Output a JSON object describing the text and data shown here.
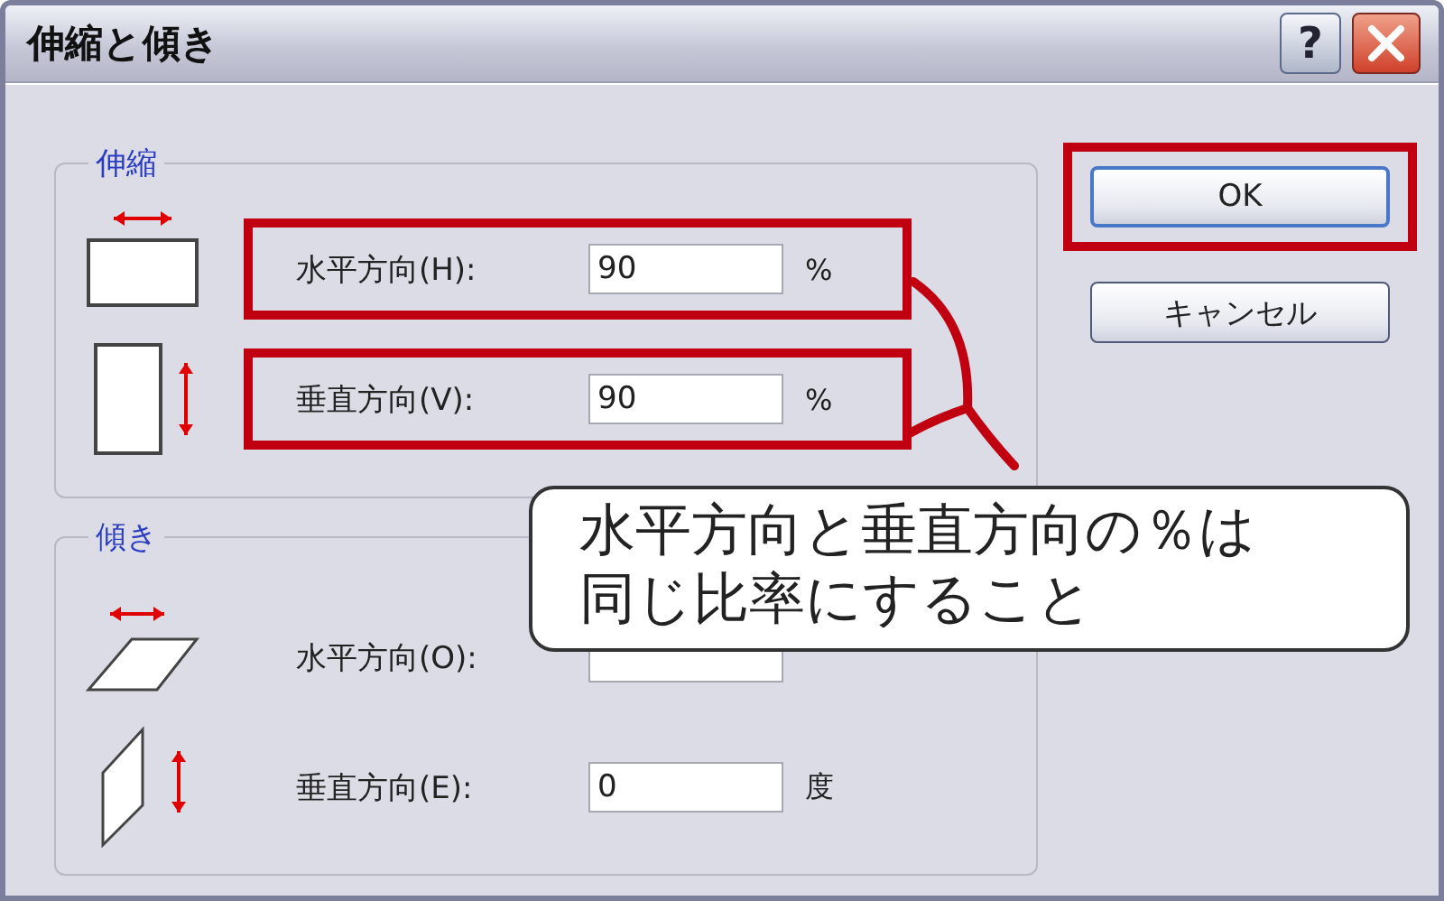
{
  "window": {
    "title": "伸縮と傾き",
    "help_label": "?"
  },
  "groups": [
    {
      "title": "伸縮",
      "rows": [
        {
          "kind": "wide",
          "label": "水平方向(H):",
          "value": "90",
          "unit": "%",
          "highlighted": true
        },
        {
          "kind": "tall",
          "label": "垂直方向(V):",
          "value": "90",
          "unit": "%",
          "highlighted": true
        }
      ]
    },
    {
      "title": "傾き",
      "rows": [
        {
          "kind": "skew-h",
          "label": "水平方向(O):",
          "highlighted": false
        },
        {
          "kind": "skew-v",
          "label": "垂直方向(E):",
          "value": "0",
          "unit": "度",
          "highlighted": false
        }
      ]
    }
  ],
  "buttons": [
    {
      "label": "OK",
      "default": true,
      "highlighted": true
    },
    {
      "label": "キャンセル",
      "default": false,
      "highlighted": false
    }
  ],
  "callout": {
    "text": "水平方向と垂直方向の％は同じ比率にすること"
  }
}
